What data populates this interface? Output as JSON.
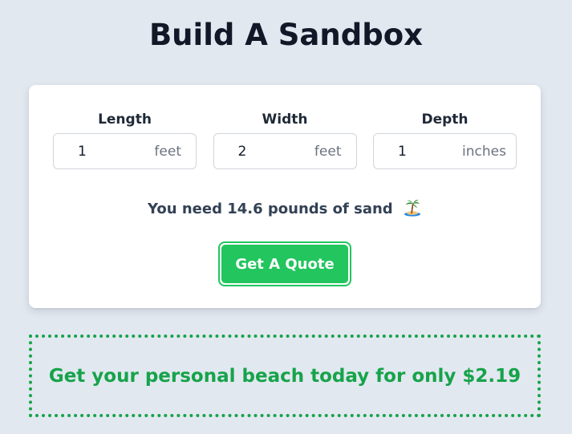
{
  "page": {
    "title": "Build A Sandbox"
  },
  "fields": [
    {
      "label": "Length",
      "value": "1",
      "unit": "feet"
    },
    {
      "label": "Width",
      "value": "2",
      "unit": "feet"
    },
    {
      "label": "Depth",
      "value": "1",
      "unit": "inches"
    }
  ],
  "result": {
    "text": "You need 14.6 pounds of sand",
    "icon": "palm-tree-island-icon"
  },
  "quote_button": {
    "label": "Get A Quote",
    "color": "#22c55e"
  },
  "promo": {
    "text": "Get your personal beach today for only $2.19",
    "color": "#16a34a"
  }
}
